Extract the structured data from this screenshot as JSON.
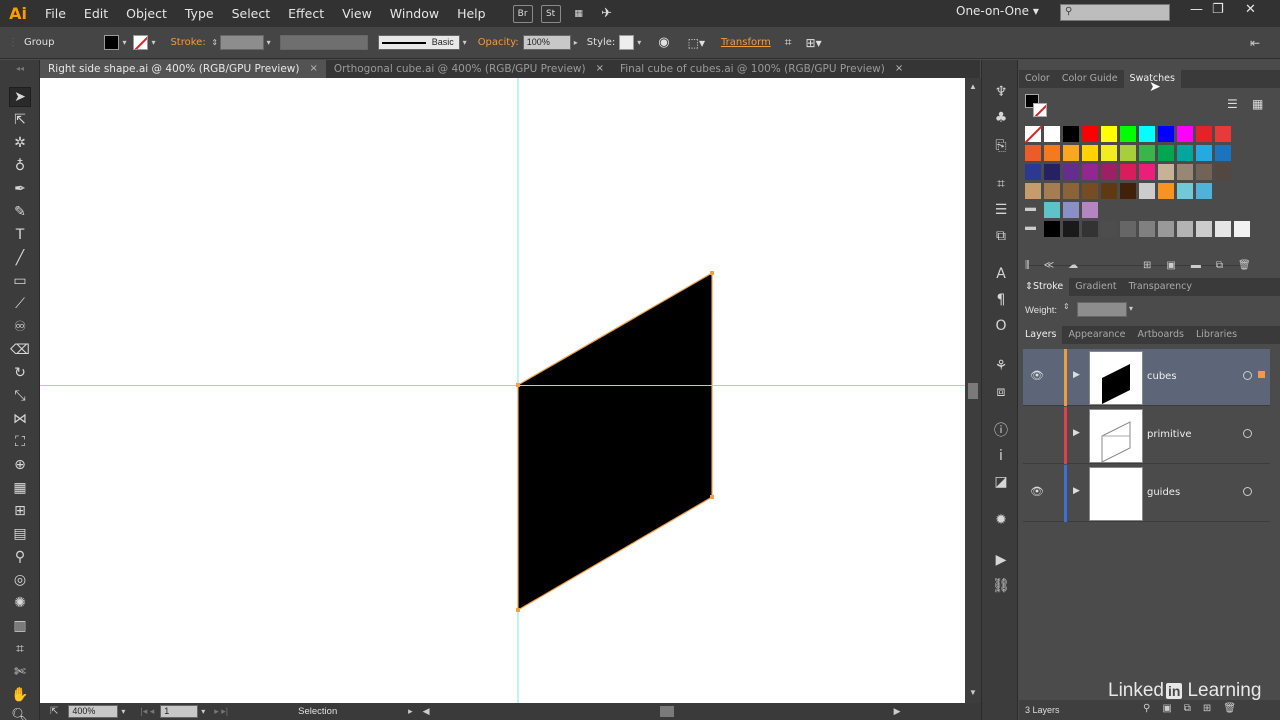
{
  "app": {
    "logo": "Ai",
    "menus": [
      "File",
      "Edit",
      "Object",
      "Type",
      "Select",
      "Effect",
      "View",
      "Window",
      "Help"
    ],
    "bridge_label": "Br",
    "stock_label": "St",
    "workspace": "One-on-One",
    "window_controls": {
      "minimize": "—",
      "restore": "❐",
      "close": "✕"
    }
  },
  "control": {
    "selection_type": "Group",
    "stroke_label": "Stroke:",
    "brush_label": "Basic",
    "opacity_label": "Opacity:",
    "opacity_value": "100%",
    "style_label": "Style:",
    "transform_label": "Transform"
  },
  "tabs": [
    {
      "title": "Right side shape.ai @ 400% (RGB/GPU Preview)",
      "close": "×"
    },
    {
      "title": "Orthogonal cube.ai @ 400% (RGB/GPU Preview)",
      "close": "×"
    },
    {
      "title": "Final cube of cubes.ai @ 100% (RGB/GPU Preview)",
      "close": "×"
    }
  ],
  "status": {
    "zoom": "400%",
    "artboard": "1",
    "mode": "Selection"
  },
  "panels": {
    "color_tabs": [
      "Color",
      "Color Guide",
      "Swatches"
    ],
    "stroke_tabs": [
      "Stroke",
      "Gradient",
      "Transparency"
    ],
    "weight_label": "Weight:",
    "layer_tabs": [
      "Layers",
      "Appearance",
      "Artboards",
      "Libraries"
    ],
    "layers": [
      {
        "name": "cubes",
        "color": "#f39b3a"
      },
      {
        "name": "primitive",
        "color": "#e0404a"
      },
      {
        "name": "guides",
        "color": "#3d6fd9"
      }
    ],
    "layers_count": "3 Layers"
  },
  "swatches": {
    "row1": [
      "#ffffff",
      "#ffffff",
      "#000000",
      "#ff0000",
      "#ffff00",
      "#00ff00",
      "#00ffff",
      "#0000ff",
      "#ff00ff",
      "#e2232a",
      "#e83a3a"
    ],
    "row2": [
      "#ef5a2a",
      "#f47a20",
      "#f7a81d",
      "#ffd200",
      "#f2ed1e",
      "#a7cf3a",
      "#3bb44a",
      "#00a650",
      "#00a79d",
      "#26a9e0",
      "#1c75bc"
    ],
    "row3": [
      "#2b3990",
      "#262262",
      "#652d90",
      "#92278f",
      "#9e1f63",
      "#d91c5c",
      "#ed1e79",
      "#c7b299",
      "#998675",
      "#736357",
      "#534741"
    ],
    "row4": [
      "#c69c6d",
      "#a67c52",
      "#8c6239",
      "#754c24",
      "#603913",
      "#42210b",
      "#cccccc",
      "#f7931e",
      "#71c8d6",
      "#4fb3d9"
    ],
    "row5": [
      "#5ec3c9",
      "#8a8fc7",
      "#b386c3"
    ],
    "row6": [
      "#000000",
      "#1a1a1a",
      "#333333",
      "#4d4d4d",
      "#666666",
      "#808080",
      "#999999",
      "#b3b3b3",
      "#cccccc",
      "#e6e6e6",
      "#f2f2f2"
    ]
  },
  "watermark": {
    "prefix": "Linked",
    "in": "in",
    "suffix": "Learning"
  }
}
